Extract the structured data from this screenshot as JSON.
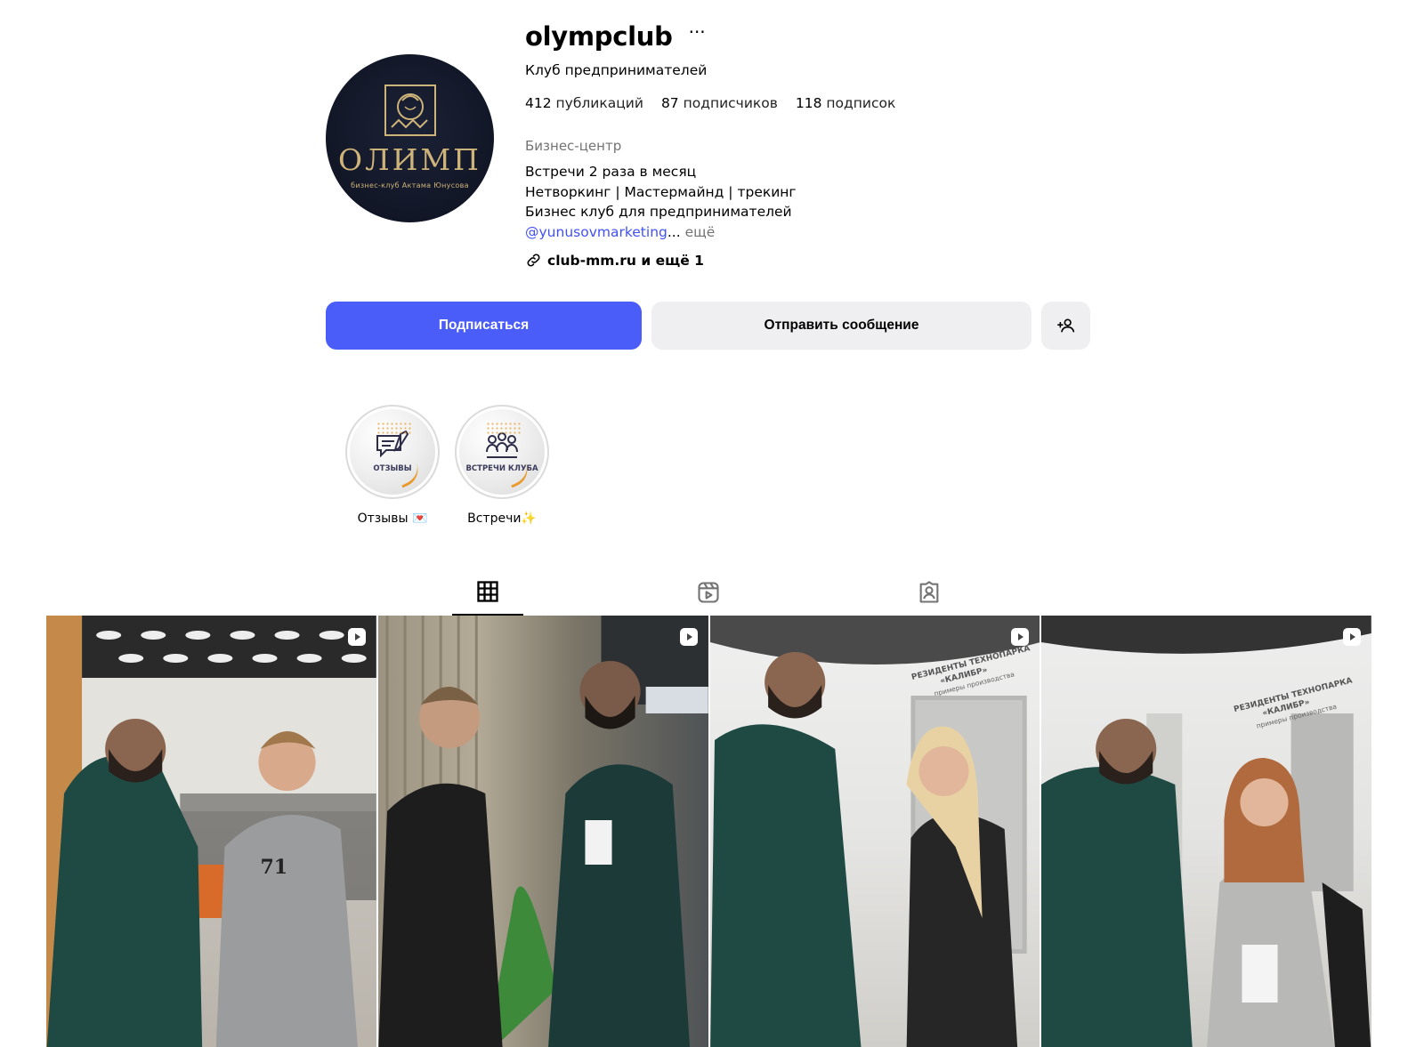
{
  "profile": {
    "username": "olympclub",
    "more_label": "···",
    "full_name": "Клуб предпринимателей",
    "avatar": {
      "logo_word": "ОЛИМП",
      "logo_sub": "бизнес-клуб Актама Юнусова"
    },
    "stats": {
      "posts_count": "412",
      "posts_label": "публикаций",
      "followers_count": "87",
      "followers_label": "подписчиков",
      "following_count": "118",
      "following_label": "подписок"
    },
    "category": "Бизнес-центр",
    "bio": {
      "line1": "Встречи 2 раза в месяц",
      "line2": "Нетворкинг | Мастермайнд | трекинг",
      "line3": "Бизнес клуб для предпринимателей",
      "mention": "@yunusovmarketing",
      "ellipsis": "...",
      "more": " ещё"
    },
    "link": {
      "text": "club-mm.ru и ещё 1",
      "icon": "link-icon"
    }
  },
  "actions": {
    "follow_label": "Подписаться",
    "message_label": "Отправить сообщение",
    "add_icon": "add-person-icon",
    "follow_color": "#4a5df9"
  },
  "highlights": [
    {
      "label": "Отзывы 💌",
      "cover_text": "ОТЗЫВЫ",
      "icon": "review-chat-icon"
    },
    {
      "label": "Встречи✨",
      "cover_text": "ВСТРЕЧИ КЛУБА",
      "icon": "meeting-group-icon"
    }
  ],
  "tabs": [
    {
      "name": "posts",
      "icon": "grid-icon",
      "active": true
    },
    {
      "name": "reels",
      "icon": "reels-icon",
      "active": false
    },
    {
      "name": "tagged",
      "icon": "tagged-icon",
      "active": false
    }
  ],
  "posts": [
    {
      "type": "reel",
      "icon": "reel-badge-icon"
    },
    {
      "type": "reel",
      "icon": "reel-badge-icon"
    },
    {
      "type": "reel",
      "icon": "reel-badge-icon"
    },
    {
      "type": "reel",
      "icon": "reel-badge-icon"
    }
  ],
  "post_texts": {
    "p3_sign_line1": "РЕЗИДЕНТЫ ТЕХНОПАРКА",
    "p3_sign_line2": "«КАЛИБР»",
    "p3_sign_line3": "примеры производства",
    "p4_sign_line1": "РЕЗИДЕНТЫ ТЕХНОПАРКА",
    "p4_sign_line2": "«КАЛИБР»",
    "p4_sign_line3": "примеры производства"
  }
}
